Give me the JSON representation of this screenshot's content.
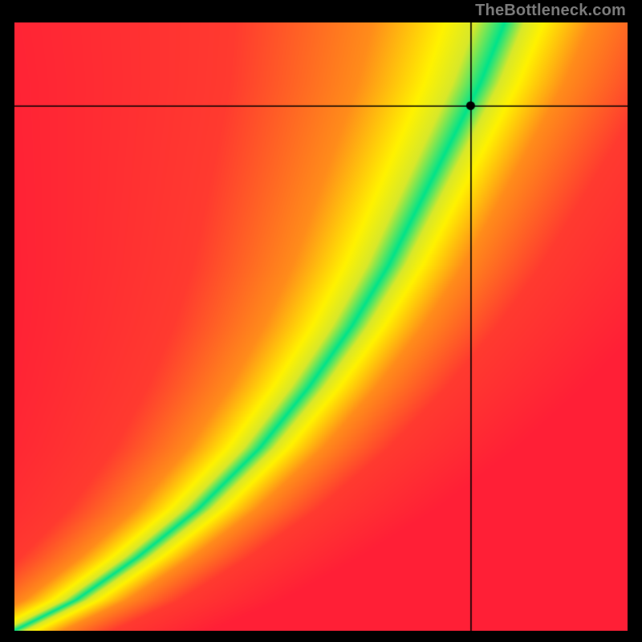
{
  "attribution": "TheBottleneck.com",
  "chart_data": {
    "type": "heatmap",
    "title": "",
    "xlabel": "",
    "ylabel": "",
    "xlim": [
      0,
      1
    ],
    "ylim": [
      0,
      1
    ],
    "marker": {
      "x": 0.745,
      "y": 0.863
    },
    "crosshair": {
      "x": 0.745,
      "y": 0.863
    },
    "ridge_points": [
      {
        "x": 0.0,
        "y": 0.0
      },
      {
        "x": 0.1,
        "y": 0.05
      },
      {
        "x": 0.2,
        "y": 0.12
      },
      {
        "x": 0.3,
        "y": 0.2
      },
      {
        "x": 0.4,
        "y": 0.3
      },
      {
        "x": 0.48,
        "y": 0.4
      },
      {
        "x": 0.55,
        "y": 0.5
      },
      {
        "x": 0.61,
        "y": 0.6
      },
      {
        "x": 0.66,
        "y": 0.7
      },
      {
        "x": 0.71,
        "y": 0.8
      },
      {
        "x": 0.76,
        "y": 0.9
      },
      {
        "x": 0.8,
        "y": 1.0
      }
    ],
    "bandwidth": 0.055,
    "color_scale": [
      {
        "d": 0.0,
        "color": "#00e38a"
      },
      {
        "d": 0.5,
        "color": "#d8e82a"
      },
      {
        "d": 1.0,
        "color": "#fff200"
      },
      {
        "d": 2.2,
        "color": "#ff8c1a"
      },
      {
        "d": 4.5,
        "color": "#ff3a2f"
      },
      {
        "d": 9.0,
        "color": "#ff1f36"
      }
    ],
    "legend": null,
    "grid": false
  }
}
